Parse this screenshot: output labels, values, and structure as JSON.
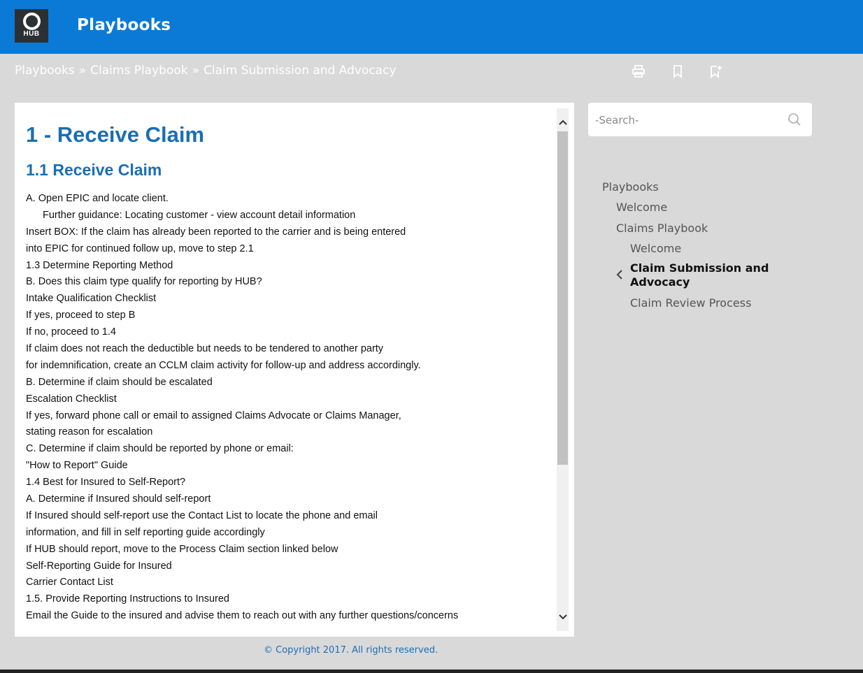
{
  "header": {
    "logo_text": "HUB",
    "title": "Playbooks"
  },
  "breadcrumb": {
    "items": [
      "Playbooks",
      "Claims Playbook",
      "Claim Submission and Advocacy"
    ],
    "separator": "»"
  },
  "toolbar": {
    "icons": [
      "print-icon",
      "bookmark-icon",
      "add-bookmark-icon"
    ]
  },
  "document": {
    "heading1": "1 - Receive Claim",
    "heading2": "1.1 Receive Claim",
    "lines": [
      "A. Open EPIC and locate client.",
      "Further guidance: Locating customer - view account detail information",
      "Insert BOX: If the claim has already been reported to the carrier and is being entered",
      "into EPIC for continued follow up, move to step 2.1",
      "1.3 Determine Reporting Method",
      "B. Does this claim type qualify for reporting by HUB?",
      "Intake Qualification Checklist",
      "If yes, proceed to step B",
      "If no, proceed to 1.4",
      "If claim does not reach the deductible but needs to be tendered to another party",
      "for indemnification, create an CCLM claim activity for follow-up and address accordingly.",
      "B. Determine if claim should be escalated",
      "Escalation Checklist",
      "If yes, forward phone call or email to assigned Claims Advocate or Claims Manager,",
      "stating reason for escalation",
      "C. Determine if claim should be reported by phone or email:",
      "\"How to Report\" Guide",
      "1.4 Best for Insured to Self-Report?",
      "A. Determine if Insured should self-report",
      "If Insured should self-report use the Contact List to locate the phone and email",
      "information, and fill in self reporting guide accordingly",
      "If HUB should report, move to the Process Claim section linked below",
      "Self-Reporting Guide for Insured",
      "Carrier Contact List",
      "1.5. Provide Reporting Instructions to Insured",
      "Email the Guide to the insured and advise them to reach out with any further questions/concerns"
    ]
  },
  "search": {
    "placeholder": "-Search-"
  },
  "nav": {
    "root": "Playbooks",
    "welcome": "Welcome",
    "claims_playbook": "Claims Playbook",
    "claims_welcome": "Welcome",
    "active": "Claim Submission and Advocacy",
    "claim_review": "Claim Review Process"
  },
  "footer": {
    "copyright": "© Copyright 2017. All rights reserved."
  },
  "colors": {
    "header_bg": "#0a7ad6",
    "heading": "#1a6fb4",
    "page_bg": "#d9d9d9"
  }
}
